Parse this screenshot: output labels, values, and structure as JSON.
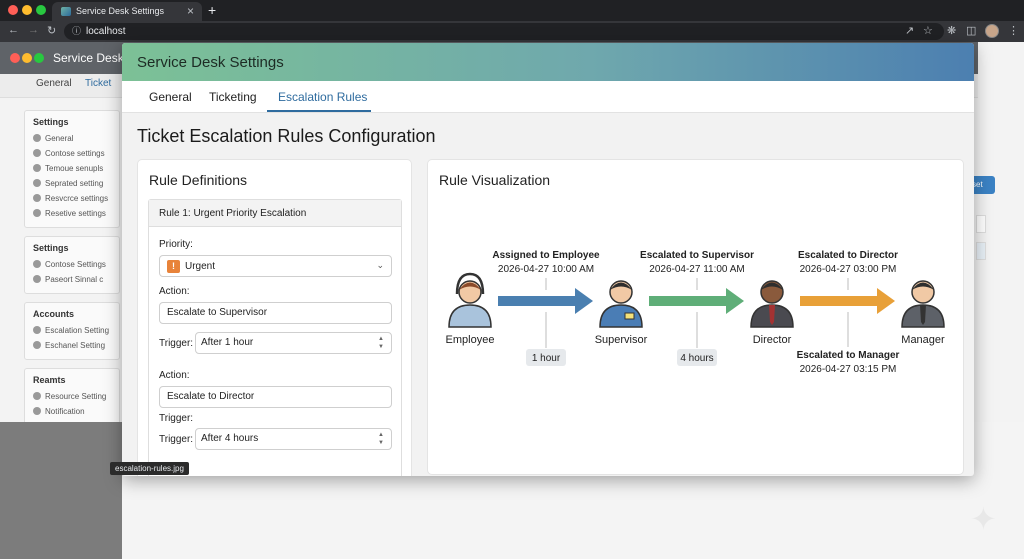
{
  "browser": {
    "tab_title": "Service Desk Settings",
    "tab_close": "×",
    "new_tab": "+",
    "url": "localhost",
    "status_tooltip": "escalation-rules.jpg"
  },
  "background_window": {
    "title": "Service Desk",
    "tabs": [
      "General",
      "Ticket"
    ],
    "groups": [
      {
        "title": "Settings",
        "items": [
          "General",
          "Contose settings",
          "Temoue senupls",
          "Seprated setting",
          "Resvcrce settings",
          "Resetive settings"
        ]
      },
      {
        "title": "Settings",
        "items": [
          "Contose Settings",
          "Paseort Sinnal c"
        ]
      },
      {
        "title": "Accounts",
        "items": [
          "Escalation Setting",
          "Eschanel Setting"
        ]
      },
      {
        "title": "Reamts",
        "items": [
          "Resource Setting",
          "Notification"
        ]
      }
    ],
    "button_label": "set"
  },
  "window": {
    "title": "Service Desk Settings",
    "tabs": [
      {
        "label": "General",
        "active": false
      },
      {
        "label": "Ticketing",
        "active": false
      },
      {
        "label": "Escalation Rules",
        "active": true
      }
    ],
    "page_title": "Ticket Escalation Rules Configuration"
  },
  "rule_definitions": {
    "title": "Rule Definitions",
    "rule_header": "Rule 1: Urgent Priority Escalation",
    "priority_label": "Priority:",
    "priority_icon": "!",
    "priority_value": "Urgent",
    "steps": [
      {
        "action_label": "Action:",
        "action_value": "Escalate to Supervisor",
        "trigger_label": "Trigger:",
        "trigger_value": "After 1 hour"
      },
      {
        "action_label": "Action:",
        "action_value": "Escalate to Director",
        "trigger_label": "Trigger:",
        "trigger_value": "After 4 hours"
      }
    ]
  },
  "visualization": {
    "title": "Rule Visualization",
    "nodes": [
      "Employee",
      "Supervisor",
      "Director",
      "Manager"
    ],
    "events": [
      {
        "label": "Assigned to Employee",
        "time": "2026-04-27 10:00 AM"
      },
      {
        "label": "Escalated to Supervisor",
        "time": "2026-04-27 11:00 AM"
      },
      {
        "label": "Escalated to Director",
        "time": "2026-04-27 03:00 PM"
      },
      {
        "label": "Escalated to Manager",
        "time": "2026-04-27 03:15 PM"
      }
    ],
    "durations": [
      "1 hour",
      "4 hours"
    ],
    "arrow_colors": [
      "#4a7fb0",
      "#5fae78",
      "#e8a038"
    ]
  }
}
